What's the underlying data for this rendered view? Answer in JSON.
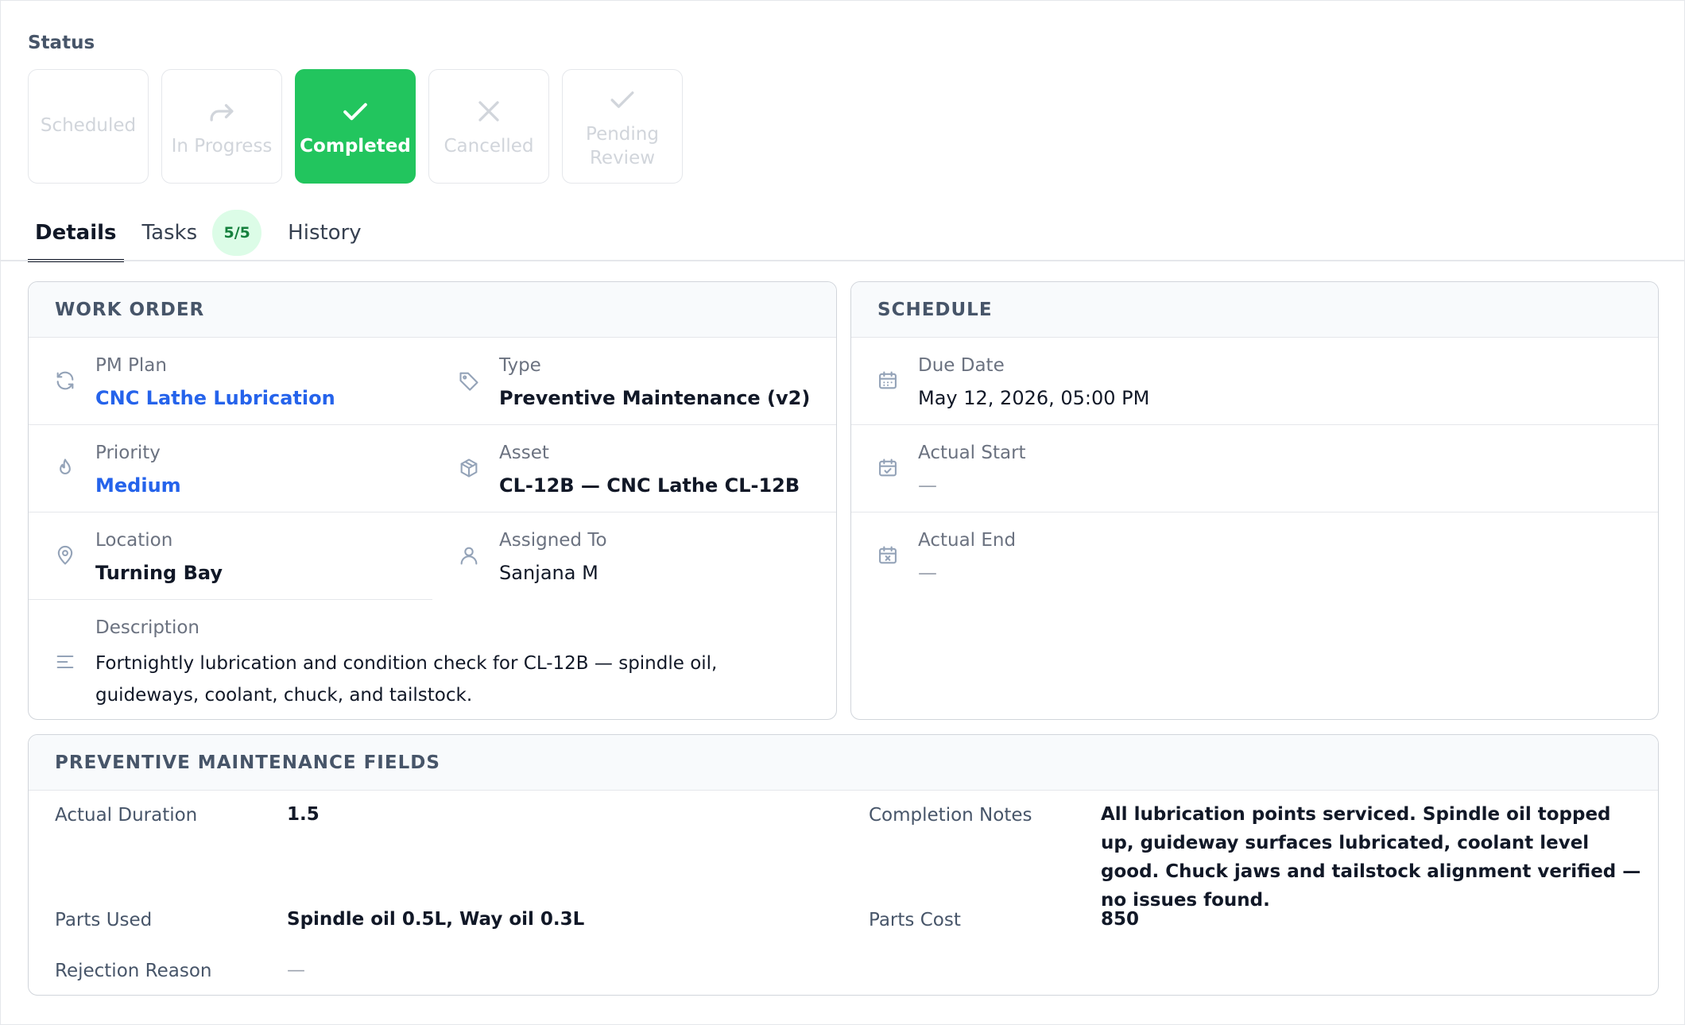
{
  "status": {
    "label": "Status",
    "options": [
      {
        "label": "Scheduled",
        "icon": "none",
        "active": false
      },
      {
        "label": "In Progress",
        "icon": "redo-arrow-icon",
        "active": false
      },
      {
        "label": "Completed",
        "icon": "check-icon",
        "active": true
      },
      {
        "label": "Cancelled",
        "icon": "x-icon",
        "active": false
      },
      {
        "label": "Pending Review",
        "icon": "check-icon",
        "active": false
      }
    ]
  },
  "tabs": {
    "details": "Details",
    "tasks": "Tasks",
    "tasks_badge": "5/5",
    "history": "History"
  },
  "work_order": {
    "title": "WORK ORDER",
    "pm_plan": {
      "label": "PM Plan",
      "value": "CNC Lathe Lubrication"
    },
    "type": {
      "label": "Type",
      "value": "Preventive Maintenance (v2)"
    },
    "priority": {
      "label": "Priority",
      "value": "Medium"
    },
    "asset": {
      "label": "Asset",
      "value": "CL-12B — CNC Lathe CL-12B"
    },
    "location": {
      "label": "Location",
      "value": "Turning Bay"
    },
    "assigned_to": {
      "label": "Assigned To",
      "value": "Sanjana M"
    },
    "description": {
      "label": "Description",
      "value": "Fortnightly lubrication and condition check for CL-12B — spindle oil, guideways, coolant, chuck, and tailstock."
    }
  },
  "schedule": {
    "title": "SCHEDULE",
    "due_date": {
      "label": "Due Date",
      "value": "May 12, 2026, 05:00 PM"
    },
    "actual_start": {
      "label": "Actual Start",
      "value": "—"
    },
    "actual_end": {
      "label": "Actual End",
      "value": "—"
    }
  },
  "pm_fields": {
    "title": "PREVENTIVE MAINTENANCE FIELDS",
    "actual_duration": {
      "label": "Actual Duration",
      "value": "1.5"
    },
    "completion_notes": {
      "label": "Completion Notes",
      "value": "All lubrication points serviced. Spindle oil topped up, guideway surfaces lubricated, coolant level good. Chuck jaws and tailstock alignment verified — no issues found."
    },
    "parts_used": {
      "label": "Parts Used",
      "value": "Spindle oil 0.5L, Way oil 0.3L"
    },
    "parts_cost": {
      "label": "Parts Cost",
      "value": "850"
    },
    "rejection_reason": {
      "label": "Rejection Reason",
      "value": "—"
    }
  },
  "colors": {
    "accent_green": "#22c55e",
    "link_blue": "#2563eb",
    "badge_bg": "#dcfce7"
  }
}
